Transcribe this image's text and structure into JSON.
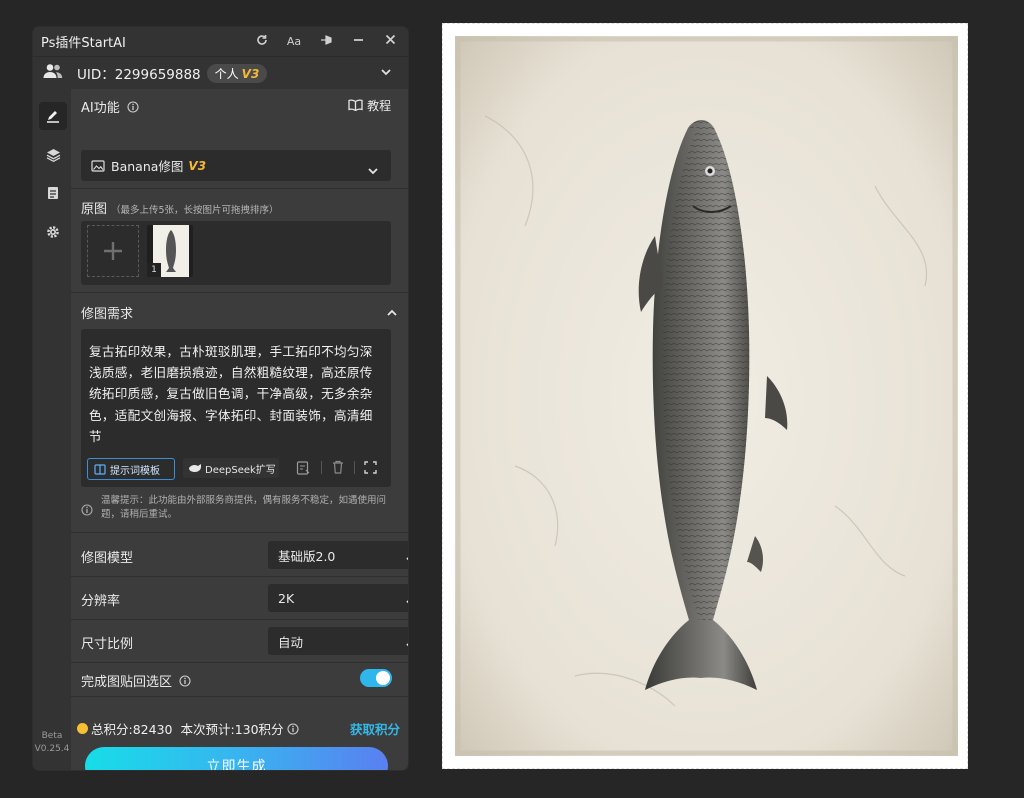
{
  "app": {
    "title": "Ps插件StartAI",
    "version_beta": "Beta",
    "version": "V0.25.4",
    "titlebar_icons": [
      "refresh-icon",
      "font-size-icon",
      "pin-icon",
      "minimize-icon",
      "close-icon"
    ],
    "font_size_label": "Aa"
  },
  "user": {
    "uid_label": "UID：2299659888",
    "plan": "个人",
    "plan_level": "V3"
  },
  "ai_feature": {
    "label": "AI功能",
    "tutorial": "教程",
    "selected_tool": "Banana修图",
    "tool_level": "V3"
  },
  "source_image": {
    "label": "原图",
    "hint": "（最多上传5张，长按图片可拖拽排序）",
    "thumbnail_index": "1"
  },
  "prompt": {
    "label": "修图需求",
    "text": "复古拓印效果，古朴斑驳肌理，手工拓印不均匀深浅质感，老旧磨损痕迹，自然粗糙纹理，高还原传统拓印质感，复古做旧色调，干净高级，无多余杂色，适配文创海报、字体拓印、封面装饰，高清细节",
    "template_button": "提示词模板",
    "deepseek_button": "DeepSeek扩写",
    "notice": "温馨提示：此功能由外部服务商提供，偶有服务不稳定，如遇使用问题，请稍后重试。"
  },
  "settings": {
    "model_label": "修图模型",
    "model_value": "基础版2.0",
    "resolution_label": "分辨率",
    "resolution_value": "2K",
    "ratio_label": "尺寸比例",
    "ratio_value": "自动",
    "paste_back_label": "完成图贴回选区",
    "paste_back_enabled": true
  },
  "footer": {
    "total_points": "总积分:82430",
    "estimate": "本次预计:130积分",
    "get_points": "获取积分",
    "generate": "立即生成"
  },
  "colors": {
    "accent": "#2fb6ea",
    "gold": "#f5b73b",
    "panel_bg": "#3c3c3c",
    "app_bg": "#262626"
  }
}
